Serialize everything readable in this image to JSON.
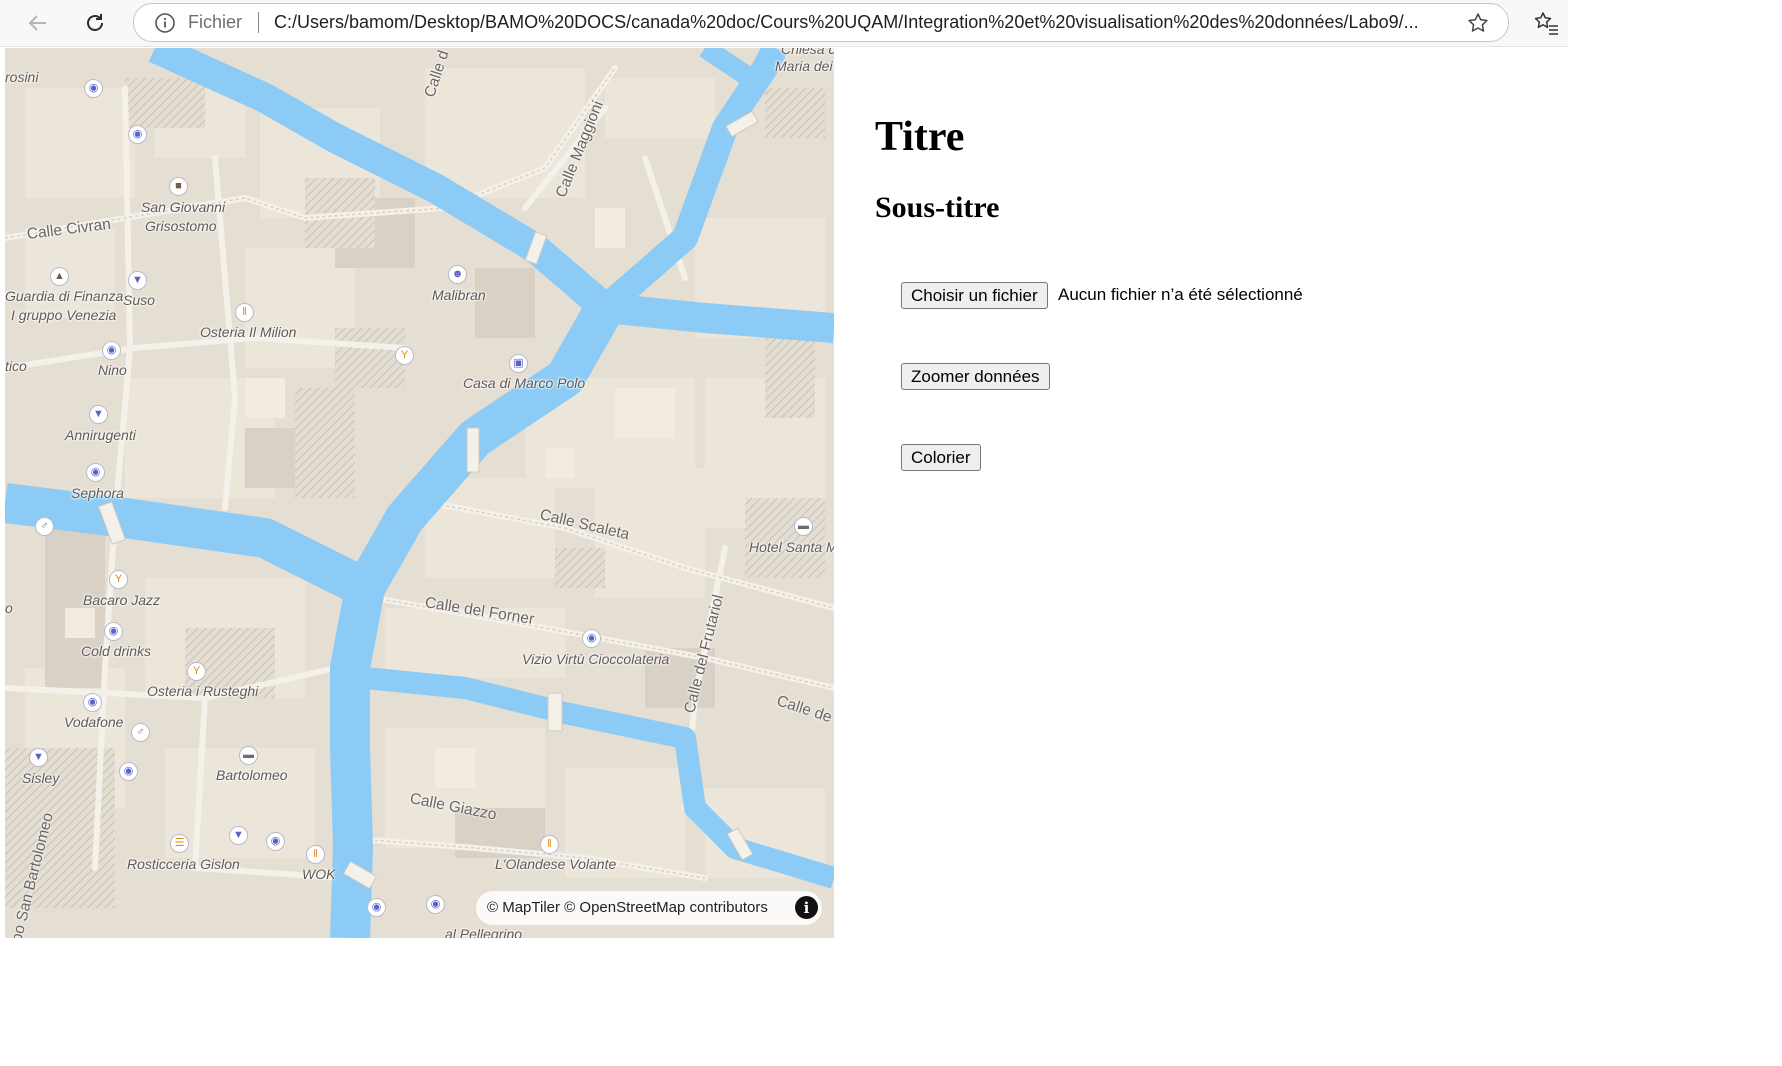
{
  "browser": {
    "scheme_label": "Fichier",
    "url": "C:/Users/bamom/Desktop/BAMO%20DOCS/canada%20doc/Cours%20UQAM/Integration%20et%20visualisation%20des%20données/Labo9/..."
  },
  "map": {
    "attribution": "© MapTiler © OpenStreetMap contributors",
    "info_glyph": "i",
    "street_labels": [
      "Calle Civran",
      "Calle Maggioni",
      "Calle Scaleta",
      "Calle del Forner",
      "Calle del Frutariol",
      "Calle Giazzo",
      "Calle de",
      "Calle d",
      "po San Bartolomeo"
    ],
    "places": {
      "rosini": "rosini",
      "san_giovanni": "San Giovanni",
      "grisostomo": "Grisostomo",
      "guardia": "Guardia di Finanza",
      "gruppo_venezia": "I gruppo Venezia",
      "suso": "Suso",
      "osteria_milion": "Osteria Il Milion",
      "malibran": "Malibran",
      "tico": "tico",
      "nino": "Nino",
      "casa_marco_polo": "Casa di Marco Polo",
      "annirugenti": "Annirugenti",
      "sephora": "Sephora",
      "hotel_santa": "Hotel Santa Ma",
      "bacaro_jazz": "Bacaro Jazz",
      "cold_drinks": "Cold drinks",
      "vizio_virtu": "Vizio Virtù Cioccolateria",
      "osteria_rusteghi": "Osteria i Rusteghi",
      "vodafone": "Vodafone",
      "bartolomeo": "Bartolomeo",
      "sisley": "Sisley",
      "rosticceria": "Rosticceria Gislon",
      "wok": "WOK",
      "olandese": "L'Olandese Volante",
      "pellegrino": "al Pellegrino",
      "chiesa": "Chiesa di",
      "maria_dei": "Maria dei I",
      "o_edge": "o"
    }
  },
  "page": {
    "title": "Titre",
    "subtitle": "Sous-titre",
    "file_button": "Choisir un fichier",
    "file_status": "Aucun fichier n’a été sélectionné",
    "zoom_button": "Zoomer données",
    "color_button": "Colorier"
  }
}
